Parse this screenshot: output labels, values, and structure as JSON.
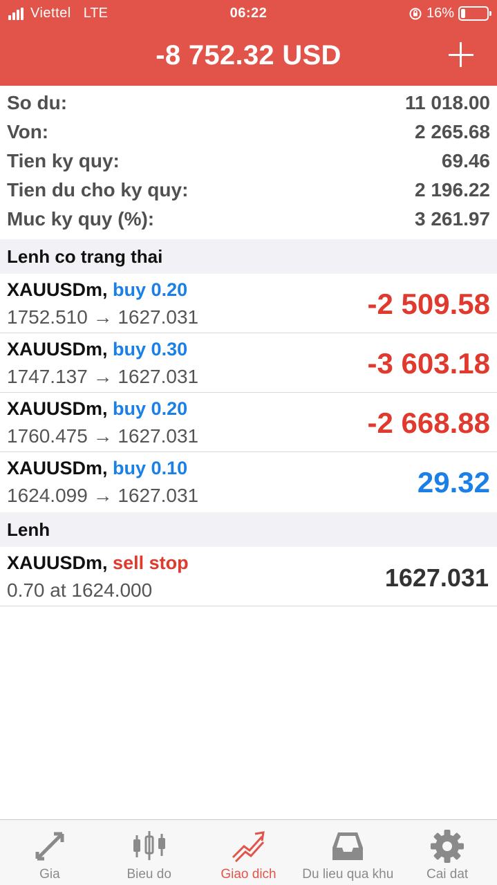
{
  "status_bar": {
    "carrier": "Viettel",
    "network": "LTE",
    "time": "06:22",
    "battery_percent_text": "16%",
    "battery_level": 0.16,
    "signal_bars": 4
  },
  "header": {
    "equity_profit": "-8 752.32 USD",
    "add_icon": "plus-icon"
  },
  "account": [
    {
      "label": "So du:",
      "value": "11 018.00"
    },
    {
      "label": "Von:",
      "value": "2 265.68"
    },
    {
      "label": "Tien ky quy:",
      "value": "69.46"
    },
    {
      "label": "Tien du cho ky quy:",
      "value": "2 196.22"
    },
    {
      "label": "Muc ky quy (%):",
      "value": "3 261.97"
    }
  ],
  "positions_section": {
    "title": "Lenh co trang thai",
    "items": [
      {
        "symbol": "XAUUSDm,",
        "type": "buy 0.20",
        "prices": "1752.510 → 1627.031",
        "profit": "-2 509.58"
      },
      {
        "symbol": "XAUUSDm,",
        "type": "buy 0.30",
        "prices": "1747.137 → 1627.031",
        "profit": "-3 603.18"
      },
      {
        "symbol": "XAUUSDm,",
        "type": "buy 0.20",
        "prices": "1760.475 → 1627.031",
        "profit": "-2 668.88"
      },
      {
        "symbol": "XAUUSDm,",
        "type": "buy 0.10",
        "prices": "1624.099 → 1627.031",
        "profit": "29.32"
      }
    ]
  },
  "orders_section": {
    "title": "Lenh",
    "items": [
      {
        "symbol": "XAUUSDm,",
        "type": "sell stop",
        "details": "0.70 at 1624.000",
        "price": "1627.031"
      }
    ]
  },
  "colors": {
    "header_bg": "#e2544a",
    "loss": "#e03a2e",
    "profit": "#1a7fe6",
    "buy": "#1a7fe6",
    "sell": "#e03a2e",
    "tab_active": "#e2544a",
    "tab_inactive": "#8a8a8a"
  },
  "tabs": [
    {
      "label": "Gia",
      "icon": "quotes-arrows-icon",
      "active": false
    },
    {
      "label": "Bieu do",
      "icon": "candlestick-chart-icon",
      "active": false
    },
    {
      "label": "Giao dich",
      "icon": "trade-chart-icon",
      "active": true
    },
    {
      "label": "Du lieu qua khu",
      "icon": "history-inbox-icon",
      "active": false
    },
    {
      "label": "Cai dat",
      "icon": "gear-icon",
      "active": false
    }
  ]
}
